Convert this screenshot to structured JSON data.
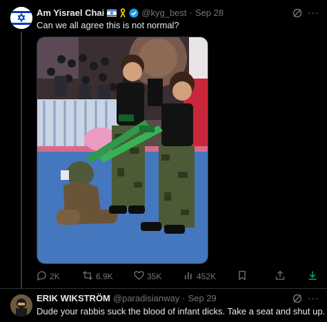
{
  "post1": {
    "name": "Am Yisrael Chai",
    "handle": "@kyg_best",
    "separator": "·",
    "date": "Sep 28",
    "text": "Can we all agree this is not normal?",
    "metrics": {
      "replies": "2K",
      "reposts": "6.9K",
      "likes": "35K",
      "views": "452K"
    }
  },
  "post2": {
    "name": "ERIK WIKSTRÖM",
    "handle": "@paradisianway",
    "separator": "·",
    "date": "Sep 29",
    "text": "Dude your rabbis suck the blood of infant dicks. Take a seat and shut up."
  },
  "more_glyph": "···",
  "colors": {
    "background": "#000000",
    "text": "#e7e9ea",
    "muted": "#71767b",
    "verified": "#1d9bf0",
    "share_active": "#00ba7c"
  }
}
